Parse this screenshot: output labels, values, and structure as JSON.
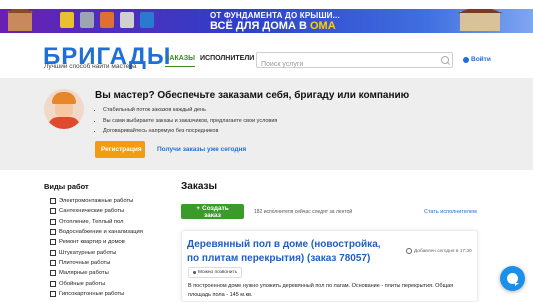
{
  "banner": {
    "line1": "ОТ ФУНДАМЕНТА ДО КРЫШИ...",
    "line2_prefix": "ВСЁ ДЛЯ ДОМА В",
    "line2_brand": "ОМА"
  },
  "header": {
    "logo": "БРИГАДЫ",
    "tagline": "Лучший способ найти мастера",
    "nav": {
      "orders": "ЗАКАЗЫ",
      "workers": "ИСПОЛНИТЕЛИ"
    },
    "search": {
      "placeholder": "Поиск услуги",
      "value": ""
    },
    "login": "Войти"
  },
  "hero": {
    "title": "Вы мастер? Обеспечьте заказами себя, бригаду или компанию",
    "bullets": [
      "Стабильный поток заказов каждый день",
      "Вы сами выбираете заказы и заказчиков, предлагаете свои условия",
      "Договаривайтесь напрямую без посредников"
    ],
    "register_button": "Регистрация",
    "orders_link": "Получи заказы уже сегодня"
  },
  "sidebar": {
    "title": "Виды работ",
    "items": [
      "Электромонтажные работы",
      "Сантехнические работы",
      "Отопление, Теплый пол",
      "Водоснабжение и канализация",
      "Ремонт квартир и домов",
      "Штукатурные работы",
      "Плиточные работы",
      "Малярные работы",
      "Обойные работы",
      "Гипсокартонные работы"
    ]
  },
  "main": {
    "title": "Заказы",
    "create_button": "Создать заказ",
    "watching": "182 исполнителя сейчас следят за лентой",
    "become_worker": "Стать исполнителем",
    "order": {
      "title": "Деревянный пол в доме (новостройка, по плитам перекрытия) (заказ 78057)",
      "added": "Добавлен сегодня в 17:30",
      "badge": "Можно позвонить",
      "description": "В построенном доме нужно уложить деревянный пол по лагам. Основание - плиты перекрытия. Общая площадь пола - 145 м.кв."
    }
  },
  "colors": {
    "brand_blue": "#1f6fd6",
    "green": "#3a9a2a",
    "orange": "#f39c12"
  }
}
